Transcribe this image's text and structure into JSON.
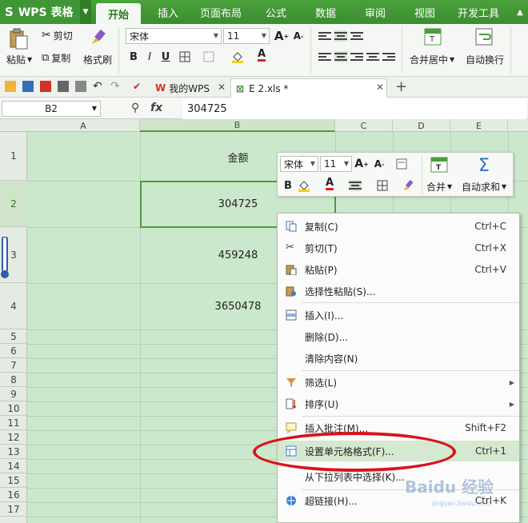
{
  "app": {
    "logo_text": "WPS 表格",
    "accent_color": "#3f9634",
    "selected_color": "#4c9c3f",
    "grid_bg": "#cce8cc"
  },
  "menu_tabs": [
    "开始",
    "插入",
    "页面布局",
    "公式",
    "数据",
    "审阅",
    "视图",
    "开发工具"
  ],
  "ribbon": {
    "paste_label": "粘贴",
    "cut_label": "剪切",
    "copy_label": "复制",
    "format_painter_label": "格式刷",
    "font_name": "宋体",
    "font_size": "11",
    "merge_center_label": "合并居中",
    "wrap_text_label": "自动换行"
  },
  "doc_tabs": [
    {
      "label": "我的WPS"
    },
    {
      "label": "E 2.xls *"
    }
  ],
  "formula_bar": {
    "name_box": "B2",
    "fx_label": "fx",
    "value": "304725"
  },
  "columns": [
    "A",
    "B",
    "C",
    "D",
    "E"
  ],
  "rows": [
    "1",
    "2",
    "3",
    "4",
    "5",
    "6",
    "7",
    "8",
    "9",
    "10",
    "11",
    "12",
    "13",
    "14",
    "15",
    "16",
    "17"
  ],
  "cells": {
    "B1": "金额",
    "B2": "304725",
    "B3": "459248",
    "B4": "3650478"
  },
  "mini_toolbar": {
    "font_name": "宋体",
    "font_size": "11",
    "merge_label": "合并",
    "autosum_label": "自动求和"
  },
  "context_menu": [
    {
      "label": "复制(C)",
      "shortcut": "Ctrl+C",
      "icon": "copy-icon"
    },
    {
      "label": "剪切(T)",
      "shortcut": "Ctrl+X",
      "icon": "scissors-icon"
    },
    {
      "label": "粘贴(P)",
      "shortcut": "Ctrl+V",
      "icon": "paste-icon"
    },
    {
      "label": "选择性粘贴(S)...",
      "shortcut": "",
      "icon": "paste-special-icon"
    },
    {
      "label": "插入(I)...",
      "shortcut": "",
      "icon": "insert-icon"
    },
    {
      "label": "删除(D)...",
      "shortcut": "",
      "icon": ""
    },
    {
      "label": "清除内容(N)",
      "shortcut": "",
      "icon": ""
    },
    {
      "label": "筛选(L)",
      "shortcut": "",
      "icon": "filter-icon",
      "submenu": true
    },
    {
      "label": "排序(U)",
      "shortcut": "",
      "icon": "sort-icon",
      "submenu": true
    },
    {
      "label": "插入批注(M)...",
      "shortcut": "Shift+F2",
      "icon": "comment-icon"
    },
    {
      "label": "设置单元格格式(F)...",
      "shortcut": "Ctrl+1",
      "icon": "format-cells-icon",
      "highlighted": true
    },
    {
      "label": "从下拉列表中选择(K)...",
      "shortcut": "",
      "icon": ""
    },
    {
      "label": "超链接(H)...",
      "shortcut": "Ctrl+K",
      "icon": "hyperlink-icon"
    }
  ],
  "watermark_text": "Baidu 经验"
}
